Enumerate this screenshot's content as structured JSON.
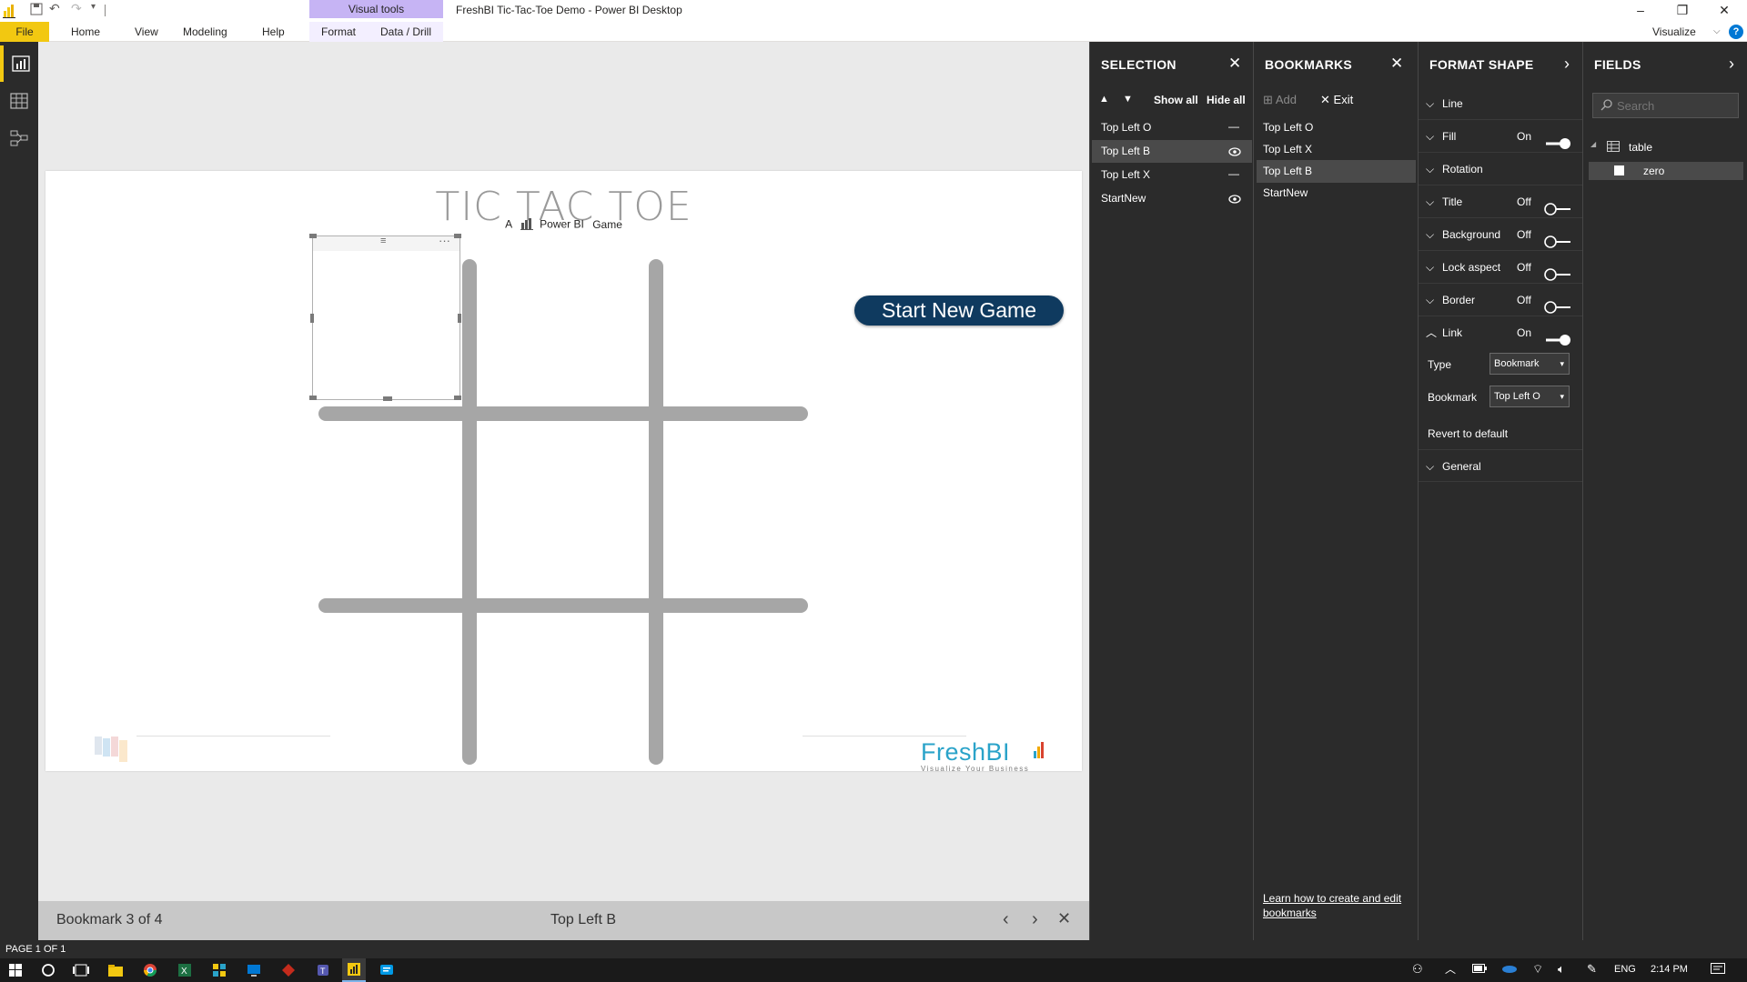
{
  "window": {
    "title": "FreshBI Tic-Tac-Toe Demo - Power BI Desktop",
    "contextual_tab_group": "Visual tools",
    "minimize": "–",
    "restore": "❐",
    "close": "✕",
    "visualize_label": "Visualize",
    "help": "?"
  },
  "ribbon": {
    "tabs": [
      "File",
      "Home",
      "View",
      "Modeling",
      "Help",
      "Format",
      "Data / Drill"
    ]
  },
  "canvas": {
    "title": "TIC TAC TOE",
    "subtitle_prefix": "A",
    "subtitle_brand": "Power BI",
    "subtitle_suffix": "Game",
    "start_button": "Start New Game",
    "logo_text": "FreshBI",
    "logo_tagline": "Visualize Your Business"
  },
  "bookmark_bar": {
    "count_text": "Bookmark 3 of 4",
    "current": "Top Left B"
  },
  "status": {
    "page": "PAGE 1 OF 1"
  },
  "selection_pane": {
    "title": "SELECTION",
    "show_all": "Show all",
    "hide_all": "Hide all",
    "items": [
      {
        "name": "Top Left O",
        "visible": false,
        "selected": false
      },
      {
        "name": "Top Left B",
        "visible": true,
        "selected": true
      },
      {
        "name": "Top Left X",
        "visible": false,
        "selected": false
      },
      {
        "name": "StartNew",
        "visible": true,
        "selected": false
      }
    ]
  },
  "bookmarks_pane": {
    "title": "BOOKMARKS",
    "add": "Add",
    "exit": "Exit",
    "items": [
      "Top Left O",
      "Top Left X",
      "Top Left B",
      "StartNew"
    ],
    "selected_index": 2,
    "help_link": "Learn how to create and edit bookmarks"
  },
  "format_pane": {
    "title": "FORMAT SHAPE",
    "sections": [
      {
        "label": "Line",
        "state": ""
      },
      {
        "label": "Fill",
        "state": "On"
      },
      {
        "label": "Rotation",
        "state": ""
      },
      {
        "label": "Title",
        "state": "Off"
      },
      {
        "label": "Background",
        "state": "Off"
      },
      {
        "label": "Lock aspect",
        "state": "Off"
      },
      {
        "label": "Border",
        "state": "Off"
      },
      {
        "label": "Link",
        "state": "On"
      }
    ],
    "type_label": "Type",
    "type_value": "Bookmark",
    "bookmark_label": "Bookmark",
    "bookmark_value": "Top Left O",
    "revert": "Revert to default",
    "general": "General"
  },
  "fields_pane": {
    "title": "FIELDS",
    "search_placeholder": "Search",
    "table": "table",
    "field": "zero"
  },
  "taskbar": {
    "time": "2:14 PM",
    "lang": "ENG"
  },
  "colors": {
    "accent": "#f2c811",
    "pane_bg": "#2b2b2b",
    "start_button": "#0f3a5f",
    "grid": "#a6a6a6"
  }
}
